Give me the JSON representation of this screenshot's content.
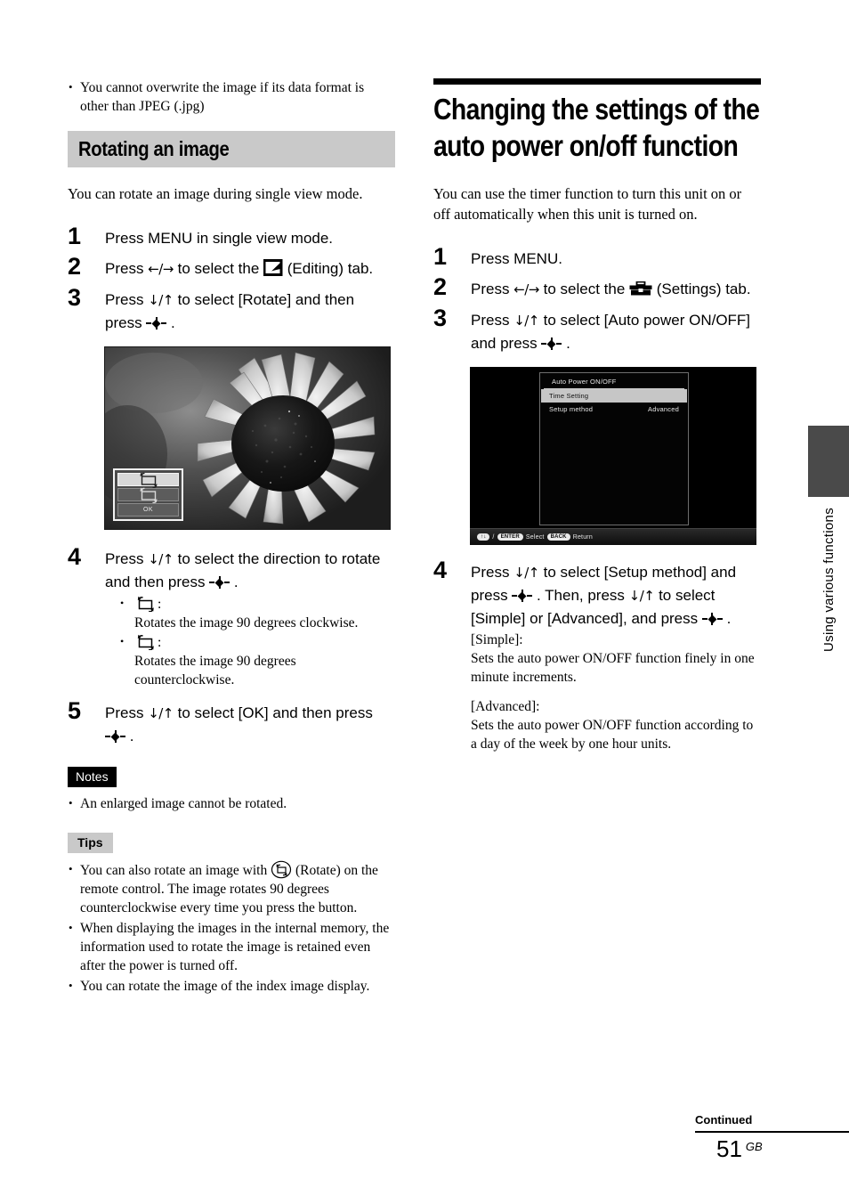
{
  "left_column": {
    "top_bullets": [
      "You cannot overwrite the image if its data format is other than JPEG (.jpg)"
    ],
    "section": {
      "title": "Rotating an image",
      "band_color": "#c9c9c9",
      "intro": "You can rotate an image during single view mode."
    },
    "steps": [
      {
        "num": "1",
        "text": "Press MENU in single view mode."
      },
      {
        "num": "2",
        "text_before": "Press ",
        "arrows": "←/→",
        "text_mid": " to select the ",
        "icon": "editing-tab-icon",
        "text_after": " (Editing) tab."
      },
      {
        "num": "3",
        "text_before": "Press ",
        "arrows": "↓/↑",
        "text_mid": " to select [Rotate] and then press ",
        "icon": "enter-key-icon",
        "text_after": " ."
      },
      {
        "num": "4",
        "text_before": "Press ",
        "arrows": "↓/↑",
        "text_mid": " to select the direction to rotate and then press ",
        "icon": "enter-key-icon",
        "text_after": " .",
        "sub_bullets": [
          {
            "icon": "rotate-clockwise-icon",
            "label": ":",
            "desc": "Rotates the image 90 degrees clockwise."
          },
          {
            "icon": "rotate-counterclockwise-icon",
            "label": ":",
            "desc": "Rotates the image 90 degrees counterclockwise."
          }
        ]
      },
      {
        "num": "5",
        "text_before": "Press ",
        "arrows": "↓/↑",
        "text_mid": " to select [OK] and then press ",
        "icon": "enter-key-icon",
        "text_after": " ."
      }
    ],
    "photo_figure": {
      "caption": "sunflower photo with rotate menu overlay",
      "menu_rows": [
        {
          "type": "icon",
          "icon": "rotate-clockwise-icon",
          "selected": true
        },
        {
          "type": "icon",
          "icon": "rotate-counterclockwise-icon",
          "selected": false
        },
        {
          "type": "label",
          "label": "OK",
          "selected": false
        }
      ]
    },
    "notes": {
      "badge": "Notes",
      "items": [
        "An enlarged image cannot be rotated."
      ]
    },
    "tips": {
      "badge": "Tips",
      "items": [
        {
          "before": "You can also rotate an image with ",
          "icon": "rotate-button-icon",
          "after": " (Rotate) on the remote control. The image rotates 90 degrees counterclockwise every time you press the button."
        },
        {
          "before": "When displaying the images in the internal memory, the information used to rotate the image is retained even after the power is turned off.",
          "icon": "",
          "after": ""
        },
        {
          "before": "You can rotate the image of the index image display.",
          "icon": "",
          "after": ""
        }
      ]
    }
  },
  "right_column": {
    "chapter_title": "Changing the settings of the auto power on/off function",
    "intro": "You can use the timer function to turn this unit on or off automatically when this unit is turned on.",
    "steps": [
      {
        "num": "1",
        "text": "Press MENU."
      },
      {
        "num": "2",
        "text_before": "Press ",
        "arrows": "←/→",
        "text_mid": " to select the ",
        "icon": "settings-tab-icon",
        "text_after": " (Settings) tab."
      },
      {
        "num": "3",
        "text_before": "Press ",
        "arrows": "↓/↑",
        "text_mid": " to select [Auto power ON/OFF] and press ",
        "icon": "enter-key-icon",
        "text_after": " ."
      },
      {
        "num": "4",
        "text_before": "Press ",
        "arrows": "↓/↑",
        "text_mid": " to select [Setup method] and press ",
        "icon": "enter-key-icon",
        "text_mid2": " . Then, press ",
        "arrows2": "↓/↑",
        "text_mid3": " to select [Simple] or [Advanced], and press ",
        "icon2": "enter-key-icon",
        "text_after": " .",
        "notes": [
          "[Simple]:",
          "Sets the auto power ON/OFF function finely in one minute increments.",
          "[Advanced]:",
          "Sets the auto power ON/OFF function according to a day of the week by one hour units."
        ]
      }
    ],
    "screen_figure": {
      "title": "Auto Power ON/OFF",
      "rows": [
        {
          "label": "Time Setting",
          "value": "",
          "selected": true
        },
        {
          "label": "Setup method",
          "value": "Advanced",
          "selected": false
        }
      ],
      "status_bar": {
        "arrow_pill": "↑↓",
        "separator": "/",
        "enter_pill": "ENTER",
        "select_label": "Select",
        "back_pill": "BACK",
        "return_label": "Return"
      }
    }
  },
  "side_tab": {
    "label": "Using various functions",
    "color": "#4a4a4a"
  },
  "footer": {
    "continued": "Continued",
    "page_number": "51",
    "region_code": "GB"
  }
}
